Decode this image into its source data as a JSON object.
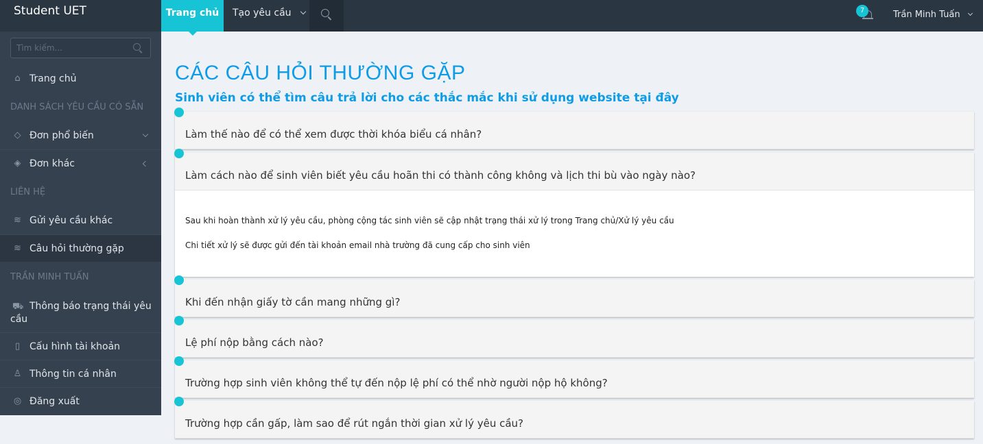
{
  "topbar": {
    "brand": "Student UET",
    "nav_home": "Trang chủ",
    "nav_request": "Tạo yêu cầu",
    "notification_count": "7",
    "user_name": "Trần Minh Tuấn"
  },
  "sidebar": {
    "search_placeholder": "Tìm kiếm...",
    "home": "Trang chủ",
    "section_requests": "DANH SÁCH YÊU CẦU CÓ SẴN",
    "popular_forms": "Đơn phổ biến",
    "other_forms": "Đơn khác",
    "section_contact": "LIÊN HỆ",
    "send_other_request": "Gửi yêu cầu khác",
    "faq": "Câu hỏi thường gặp",
    "section_user": "TRẦN MINH TUẤN",
    "status_notifications": "Thông báo trạng thái yêu cầu",
    "account_settings": "Cấu hình tài khoản",
    "personal_info": "Thông tin cá nhân",
    "logout": "Đăng xuất"
  },
  "main": {
    "title": "CÁC CÂU HỎI THƯỜNG GẶP",
    "subtitle": "Sinh viên có thể tìm câu trả lời cho các thắc mắc khi sử dụng website tại đây",
    "faqs": [
      {
        "question": "Làm thế nào để có thể xem được thời khóa biểu cá nhân?"
      },
      {
        "question": "Làm cách nào để sinh viên biết yêu cầu hoãn thi có thành công không và lịch thi bù vào ngày nào?",
        "answer_1": "Sau khi hoàn thành xử lý yêu cầu, phòng cộng tác sinh viên sẽ cập nhật trạng thái xử lý trong Trang chủ/Xử lý yêu cầu",
        "answer_2": "Chi tiết xử lý sẽ được gửi đến tài khoản email nhà trường đã cung cấp cho sinh viên"
      },
      {
        "question": "Khi đến nhận giấy tờ cần mang những gì?"
      },
      {
        "question": "Lệ phí nộp bằng cách nào?"
      },
      {
        "question": "Trường hợp sinh viên không thể tự đến nộp lệ phí có thể nhờ người nộp hộ không?"
      },
      {
        "question": "Trường hợp cần gấp, làm sao để rút ngắn thời gian xử lý yêu cầu?"
      }
    ]
  },
  "colors": {
    "accent": "#17c4d6",
    "title_blue": "#0f9ce6",
    "sidebar_bg": "#364150",
    "topbar_bg": "#2b3643"
  }
}
